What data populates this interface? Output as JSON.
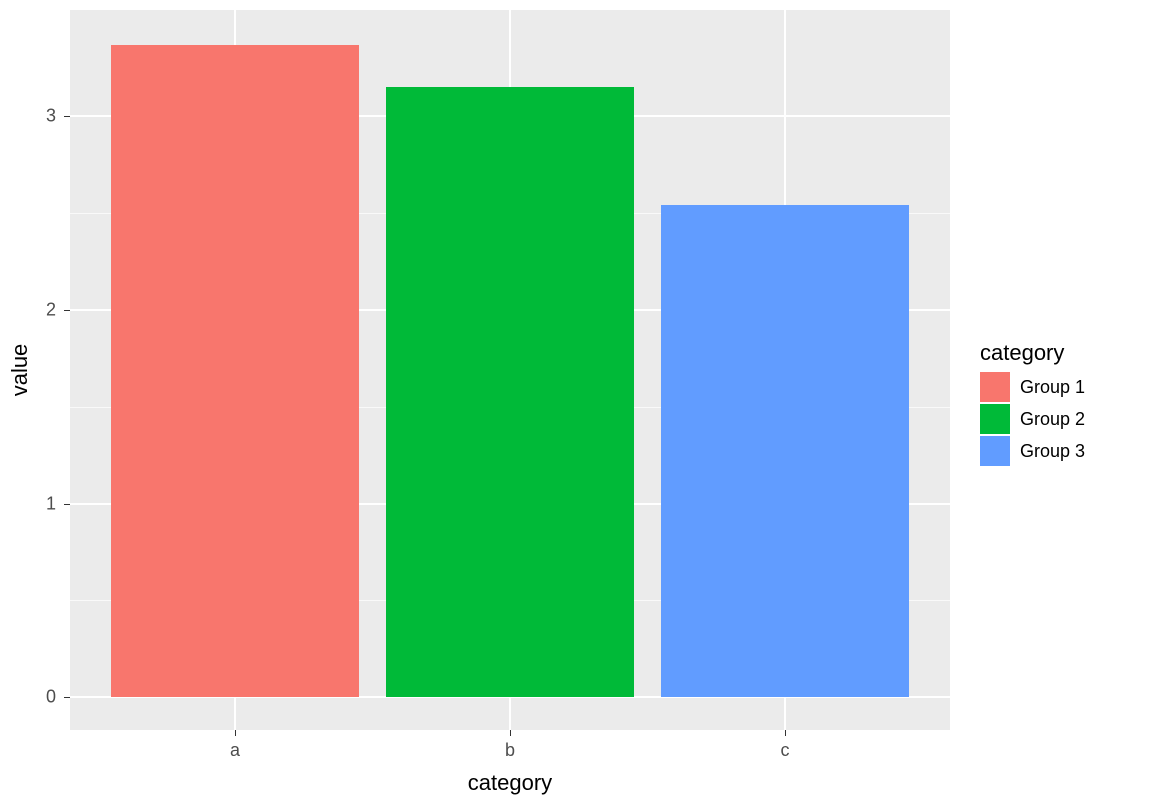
{
  "chart_data": {
    "type": "bar",
    "categories": [
      "a",
      "b",
      "c"
    ],
    "values": [
      3.37,
      3.15,
      2.54
    ],
    "series_labels": [
      "Group 1",
      "Group 2",
      "Group 3"
    ],
    "colors": [
      "#F8766D",
      "#00BA38",
      "#619CFF"
    ],
    "xlabel": "category",
    "ylabel": "value",
    "legend_title": "category",
    "y_ticks": [
      0,
      1,
      2,
      3
    ],
    "y_minor": [
      0.5,
      1.5,
      2.5
    ],
    "ylim": [
      -0.17,
      3.55
    ]
  }
}
